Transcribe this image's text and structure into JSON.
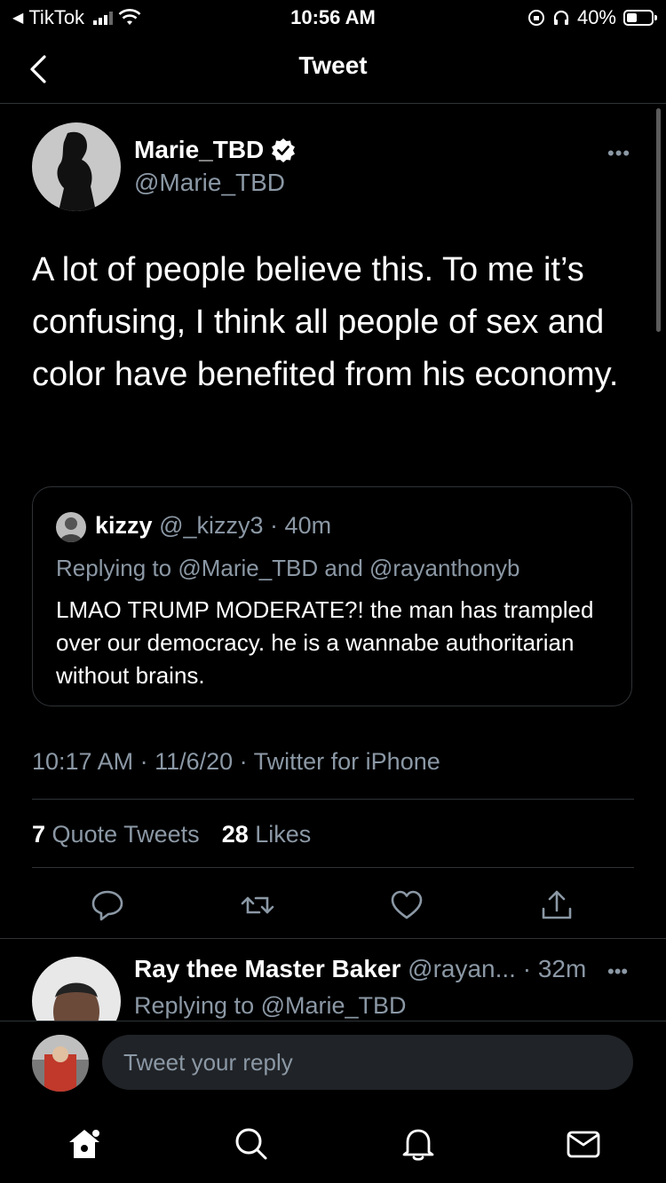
{
  "status_bar": {
    "back_app": "TikTok",
    "time": "10:56 AM",
    "battery": "40%"
  },
  "header": {
    "title": "Tweet"
  },
  "tweet": {
    "display_name": "Marie_TBD",
    "handle": "@Marie_TBD",
    "text": "A lot of people believe this. To me it’s confusing, I think all people of sex and color have benefited from his economy.",
    "quote": {
      "name": "kizzy",
      "handle": "@_kizzy3",
      "time": "40m",
      "replying_label": "Replying to ",
      "replying_to": "@Marie_TBD and @rayanthonyb",
      "text": "LMAO TRUMP MODERATE?! the man has trampled over our democracy. he is a wannabe authoritarian without brains."
    },
    "timestamp": "10:17 AM · 11/6/20 · Twitter for iPhone",
    "stats": {
      "quote_count": "7",
      "quote_label": "Quote Tweets",
      "like_count": "28",
      "like_label": "Likes"
    }
  },
  "reply": {
    "display_name": "Ray thee Master Baker",
    "handle": "@rayan...",
    "time": "· 32m",
    "replying_label": "Replying to ",
    "replying_to": "@Marie_TBD"
  },
  "composer": {
    "placeholder": "Tweet your reply"
  },
  "icons": {
    "verified": "verified-badge-icon",
    "more": "more-horizontal-icon",
    "reply": "reply-icon",
    "retweet": "retweet-icon",
    "like": "heart-icon",
    "share": "share-icon",
    "home": "home-icon",
    "search": "search-icon",
    "notifications": "bell-icon",
    "messages": "mail-icon"
  },
  "colors": {
    "background": "#000000",
    "text": "#ffffff",
    "muted": "#8b98a5",
    "border": "#2f3336"
  }
}
